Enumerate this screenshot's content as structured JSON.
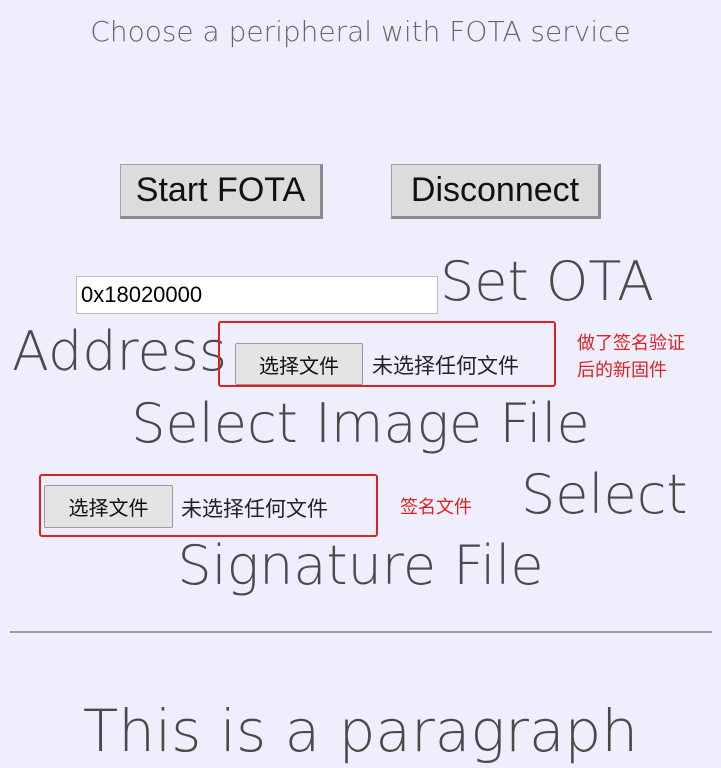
{
  "header": {
    "subtitle": "Choose a peripheral with FOTA service"
  },
  "buttons": {
    "start_fota": "Start FOTA",
    "disconnect": "Disconnect"
  },
  "ota_address": {
    "value": "0x18020000",
    "label_part1": "Set OTA",
    "label_part2": "Address"
  },
  "image_file": {
    "button_label": "选择文件",
    "status": "未选择任何文件",
    "label": "Select Image File",
    "annotation_line1": "做了签名验证",
    "annotation_line2": "后的新固件"
  },
  "signature_file": {
    "button_label": "选择文件",
    "status": "未选择任何文件",
    "label_part1": "Select",
    "label_part2": "Signature File",
    "annotation": "签名文件"
  },
  "paragraph": {
    "text": "This is a paragraph"
  },
  "colors": {
    "background": "#eeeefc",
    "annotation_red": "#e02020",
    "button_gray": "#dcdcdc"
  }
}
